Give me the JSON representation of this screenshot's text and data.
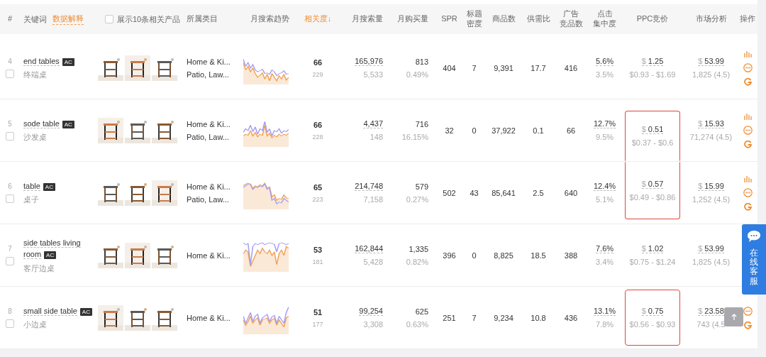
{
  "header": {
    "index_label": "#",
    "keyword_label": "关键词",
    "explain_link": "数据解释",
    "show_products": {
      "label": "展示10条相关产品",
      "checked": false
    },
    "columns": [
      {
        "label": "所属类目",
        "sorted": false
      },
      {
        "label": "月搜索趋势",
        "sorted": false
      },
      {
        "label": "相关度↓",
        "sorted": true
      },
      {
        "label": "月搜索量",
        "sorted": false
      },
      {
        "label": "月购买量",
        "sorted": false
      },
      {
        "label": "SPR",
        "sorted": false
      },
      {
        "label": [
          "标题",
          "密度"
        ],
        "sorted": false
      },
      {
        "label": "商品数",
        "sorted": false
      },
      {
        "label": "供需比",
        "sorted": false
      },
      {
        "label": [
          "广告",
          "竞品数"
        ],
        "sorted": false
      },
      {
        "label": [
          "点击",
          "集中度"
        ],
        "sorted": false
      },
      {
        "label": "PPC竞价",
        "sorted": false
      },
      {
        "label": "市场分析",
        "sorted": false
      },
      {
        "label": "操作",
        "sorted": false
      }
    ]
  },
  "rows": [
    {
      "index": "4",
      "keyword": "end tables",
      "badge": "AC",
      "translation": "终端桌",
      "checked": false,
      "thumbnails": [
        {
          "kind": "picture"
        },
        {
          "kind": "picture"
        },
        {
          "kind": "picture"
        }
      ],
      "categories": [
        "Home & Ki...",
        "Patio, Law..."
      ],
      "relevance": "66",
      "relevance_sub": "229",
      "search": "165,976",
      "search_sub": "5,533",
      "purchase": "813",
      "purchase_pct": "0.49%",
      "spr": "404",
      "title_density": "7",
      "products": "9,391",
      "supply_ratio": "17.7",
      "ad_products": "416",
      "click": "5.6%",
      "click_sub": "3.5%",
      "ppc": {
        "currency": "$",
        "value": "1.25",
        "range": "$0.93 - $1.69",
        "highlighted": false
      },
      "market": {
        "currency": "$",
        "value": "53.99",
        "reviews": "1,825 (4.5)"
      }
    },
    {
      "index": "5",
      "keyword": "sode table",
      "badge": "AC",
      "translation": "沙发桌",
      "checked": false,
      "thumbnails": [
        {
          "kind": "picture"
        },
        {
          "kind": "picture"
        },
        {
          "kind": "picture"
        }
      ],
      "categories": [
        "Home & Ki...",
        "Patio, Law..."
      ],
      "relevance": "66",
      "relevance_sub": "228",
      "search": "4,437",
      "search_sub": "148",
      "purchase": "716",
      "purchase_pct": "16.15%",
      "spr": "32",
      "title_density": "0",
      "products": "37,922",
      "supply_ratio": "0.1",
      "ad_products": "66",
      "click": "12.7%",
      "click_sub": "9.5%",
      "ppc": {
        "currency": "$",
        "value": "0.51",
        "range": "$0.37 - $0.6",
        "highlighted": true
      },
      "market": {
        "currency": "$",
        "value": "15.93",
        "reviews": "71,274 (4.5)"
      }
    },
    {
      "index": "6",
      "keyword": "table",
      "badge": "AC",
      "translation": "桌子",
      "checked": false,
      "thumbnails": [
        {
          "kind": "picture"
        },
        {
          "kind": "picture"
        },
        {
          "kind": "picture"
        }
      ],
      "categories": [
        "Home & Ki...",
        "Patio, Law..."
      ],
      "relevance": "65",
      "relevance_sub": "223",
      "search": "214,748",
      "search_sub": "7,158",
      "purchase": "579",
      "purchase_pct": "0.27%",
      "spr": "502",
      "title_density": "43",
      "products": "85,641",
      "supply_ratio": "2.5",
      "ad_products": "640",
      "click": "12.4%",
      "click_sub": "5.1%",
      "ppc": {
        "currency": "$",
        "value": "0.57",
        "range": "$0.49 - $0.86",
        "highlighted": true
      },
      "market": {
        "currency": "$",
        "value": "15.99",
        "reviews": "1,252 (4.5)"
      }
    },
    {
      "index": "7",
      "keyword": "side tables living room",
      "badge": "AC",
      "translation": "客厅边桌",
      "checked": false,
      "thumbnails": [
        {
          "kind": "picture"
        },
        {
          "kind": "picture"
        },
        {
          "kind": "picture"
        }
      ],
      "categories": [
        "Home & Ki..."
      ],
      "relevance": "53",
      "relevance_sub": "181",
      "search": "162,844",
      "search_sub": "5,428",
      "purchase": "1,335",
      "purchase_pct": "0.82%",
      "spr": "396",
      "title_density": "0",
      "products": "8,825",
      "supply_ratio": "18.5",
      "ad_products": "388",
      "click": "7.6%",
      "click_sub": "3.4%",
      "ppc": {
        "currency": "$",
        "value": "1.02",
        "range": "$0.75 - $1.24",
        "highlighted": false
      },
      "market": {
        "currency": "$",
        "value": "53.99",
        "reviews": "1,825 (4.5)"
      }
    },
    {
      "index": "8",
      "keyword": "small side table",
      "badge": "AC",
      "translation": "小边桌",
      "checked": false,
      "thumbnails": [
        {
          "kind": "picture"
        },
        {
          "kind": "picture"
        },
        {
          "kind": "picture"
        }
      ],
      "categories": [
        "Home & Ki..."
      ],
      "relevance": "51",
      "relevance_sub": "177",
      "search": "99,254",
      "search_sub": "3,308",
      "purchase": "625",
      "purchase_pct": "0.63%",
      "spr": "251",
      "title_density": "7",
      "products": "9,234",
      "supply_ratio": "10.8",
      "ad_products": "436",
      "click": "13.1%",
      "click_sub": "7.8%",
      "ppc": {
        "currency": "$",
        "value": "0.75",
        "range": "$0.56 - $0.93",
        "highlighted": true
      },
      "market": {
        "currency": "$",
        "value": "23.58",
        "reviews": "743 (4.5"
      }
    }
  ],
  "chat_widget": {
    "label": "在线客服"
  }
}
